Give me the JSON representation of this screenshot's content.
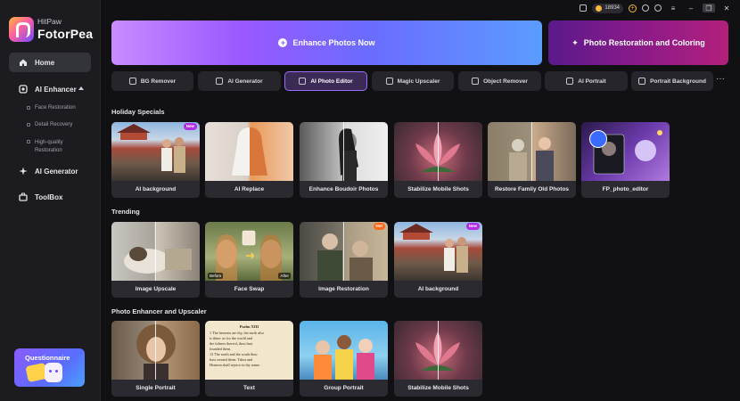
{
  "app": {
    "brand_small": "HitPaw",
    "brand_big": "FotorPea"
  },
  "titlebar": {
    "credits": "18934"
  },
  "sidebar": {
    "home": "Home",
    "ai_enhancer": "AI Enhancer",
    "sub": [
      "Face Restoration",
      "Detail Recovery",
      "High-quality Restoration"
    ],
    "ai_generator": "AI Generator",
    "toolbox": "ToolBox",
    "questionnaire": "Questionnaire"
  },
  "hero": {
    "enhance": "Enhance Photos Now",
    "restore": "Photo Restoration and Coloring"
  },
  "tools": [
    "BG Remover",
    "AI Generator",
    "AI Photo Editor",
    "Magic Upscaler",
    "Object Remover",
    "AI Portrait",
    "Portrait Background"
  ],
  "tools_active": "AI Photo Editor",
  "sections": {
    "holiday": {
      "title": "Holiday Specials",
      "cards": [
        "AI background",
        "AI Replace",
        "Enhance Boudoir Photos",
        "Stabilize Mobile Shots",
        "Restore Family Old Photos",
        "FP_photo_editor"
      ]
    },
    "trending": {
      "title": "Trending",
      "cards": [
        "Image Upscale",
        "Face Swap",
        "Image Restoration",
        "AI background"
      ]
    },
    "enhancer": {
      "title": "Photo Enhancer and Upscaler",
      "cards": [
        "Single Portrait",
        "Text",
        "Group Portrait",
        "Stabilize Mobile Shots"
      ]
    }
  },
  "badges": {
    "new": "New",
    "hot": "Hot"
  },
  "faceswap_tags": {
    "before": "Before",
    "after": "After"
  },
  "text_card": {
    "heading": "Psalm XIII",
    "lines": [
      "1 The heavens are thy, the earth also",
      "is thine: as for the world and",
      "the fulness thereof, thou hast",
      "founded them.",
      "12 The north and the south thou",
      "hast created them: Tabor and",
      "Hermon shall rejoice in thy name."
    ]
  },
  "colors": {
    "accent": "#9b6cff",
    "hot": "#ff6a1a",
    "new": "#b02ce6",
    "coin": "#f4b93a"
  }
}
